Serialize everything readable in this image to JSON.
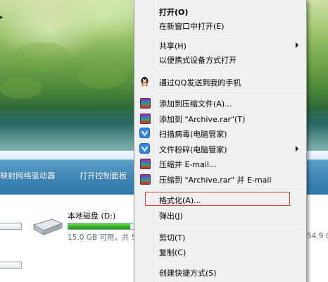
{
  "desktop": {
    "command_bar": {
      "items": [
        "映射网络驱动器",
        "打开控制面板"
      ]
    },
    "drive": {
      "name": "本地磁盘 (D:)",
      "free_text": "15.0 GB 可用，共 5",
      "usage_fraction": 0.73,
      "right_size_text": "54.9 G"
    }
  },
  "context_menu": {
    "items": [
      {
        "label": "打开(O)",
        "bold": true
      },
      {
        "label": "在新窗口中打开(E)"
      },
      {
        "label": "共享(H)",
        "submenu": true
      },
      {
        "label": "以便携式设备方式打开"
      },
      {
        "label": "通过QQ发送到我的手机",
        "icon": "qq-penguin-icon"
      },
      {
        "label": "添加到压缩文件(A)...",
        "icon": "winrar-icon"
      },
      {
        "label": "添加到 \"Archive.rar\"(T)",
        "icon": "winrar-icon"
      },
      {
        "label": "扫描病毒(电脑管家)",
        "icon": "tencent-shield-icon"
      },
      {
        "label": "文件粉碎(电脑管家)",
        "icon": "tencent-shield-icon",
        "submenu": true
      },
      {
        "label": "压缩并 E-mail...",
        "icon": "winrar-icon"
      },
      {
        "label": "压缩到 \"Archive.rar\" 并 E-mail",
        "icon": "winrar-icon"
      },
      {
        "label": "格式化(A)...",
        "highlighted": true
      },
      {
        "label": "弹出(J)"
      },
      {
        "label": "剪切(T)"
      },
      {
        "label": "复制(C)"
      },
      {
        "label": "创建快捷方式(S)"
      }
    ]
  },
  "colors": {
    "highlight_border": "#e03c31",
    "menu_bg": "#f0f0f0",
    "command_bar": "#3f88b5",
    "drive_bar_fill": "#34b11e"
  }
}
